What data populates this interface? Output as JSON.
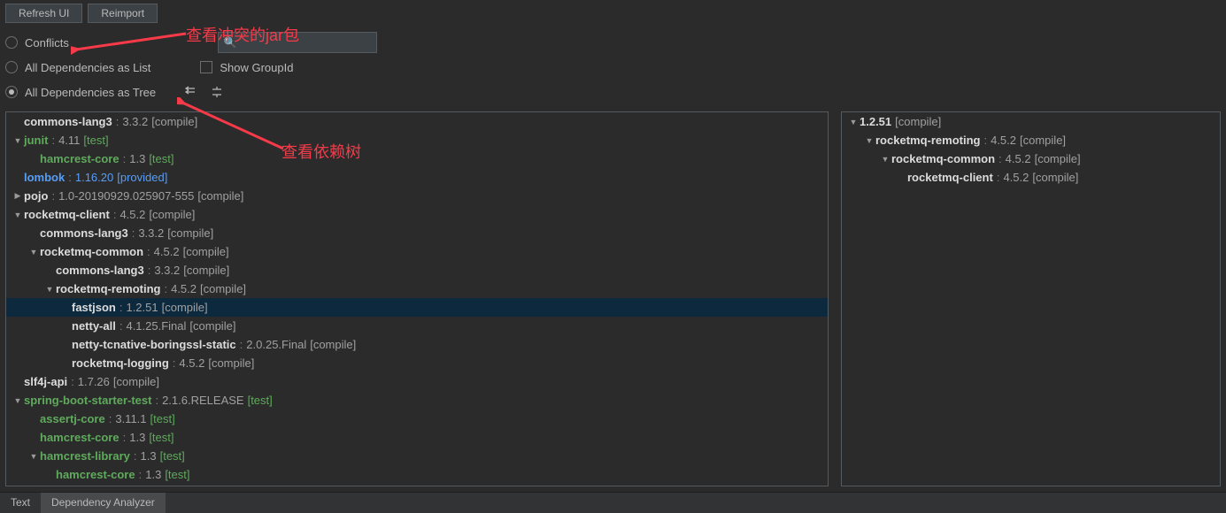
{
  "toolbar": {
    "refresh_label": "Refresh UI",
    "reimport_label": "Reimport"
  },
  "view": {
    "conflicts_label": "Conflicts",
    "list_label": "All Dependencies as List",
    "tree_label": "All Dependencies as Tree",
    "show_groupid_label": "Show GroupId",
    "search_placeholder": ""
  },
  "annotations": {
    "conflicts_note": "查看冲突的jar包",
    "tree_note": "查看依赖树"
  },
  "left_tree": [
    {
      "indent": 0,
      "tri": "none",
      "artifact": "commons-lang3",
      "aclass": "white",
      "sep": ":",
      "ver": "3.3.2",
      "scope": "[compile]",
      "vclass": "",
      "sclass": "",
      "sel": false
    },
    {
      "indent": 0,
      "tri": "down",
      "artifact": "junit",
      "aclass": "green",
      "sep": ":",
      "ver": "4.11",
      "scope": "[test]",
      "vclass": "",
      "sclass": "green",
      "sel": false
    },
    {
      "indent": 1,
      "tri": "none",
      "artifact": "hamcrest-core",
      "aclass": "green",
      "sep": ":",
      "ver": "1.3",
      "scope": "[test]",
      "vclass": "",
      "sclass": "green",
      "sel": false
    },
    {
      "indent": 0,
      "tri": "none",
      "artifact": "lombok",
      "aclass": "blue",
      "sep": ":",
      "ver": "1.16.20",
      "scope": "[provided]",
      "vclass": "blue",
      "sclass": "blue",
      "sel": false
    },
    {
      "indent": 0,
      "tri": "right",
      "artifact": "pojo",
      "aclass": "white",
      "sep": ":",
      "ver": "1.0-20190929.025907-555",
      "scope": "[compile]",
      "vclass": "",
      "sclass": "",
      "sel": false
    },
    {
      "indent": 0,
      "tri": "down",
      "artifact": "rocketmq-client",
      "aclass": "white",
      "sep": ":",
      "ver": "4.5.2",
      "scope": "[compile]",
      "vclass": "",
      "sclass": "",
      "sel": false
    },
    {
      "indent": 1,
      "tri": "none",
      "artifact": "commons-lang3",
      "aclass": "white",
      "sep": ":",
      "ver": "3.3.2",
      "scope": "[compile]",
      "vclass": "",
      "sclass": "",
      "sel": false
    },
    {
      "indent": 1,
      "tri": "down",
      "artifact": "rocketmq-common",
      "aclass": "white",
      "sep": ":",
      "ver": "4.5.2",
      "scope": "[compile]",
      "vclass": "",
      "sclass": "",
      "sel": false
    },
    {
      "indent": 2,
      "tri": "none",
      "artifact": "commons-lang3",
      "aclass": "white",
      "sep": ":",
      "ver": "3.3.2",
      "scope": "[compile]",
      "vclass": "",
      "sclass": "",
      "sel": false
    },
    {
      "indent": 2,
      "tri": "down",
      "artifact": "rocketmq-remoting",
      "aclass": "white",
      "sep": ":",
      "ver": "4.5.2",
      "scope": "[compile]",
      "vclass": "",
      "sclass": "",
      "sel": false
    },
    {
      "indent": 3,
      "tri": "none",
      "artifact": "fastjson",
      "aclass": "white",
      "sep": ":",
      "ver": "1.2.51",
      "scope": "[compile]",
      "vclass": "",
      "sclass": "",
      "sel": true
    },
    {
      "indent": 3,
      "tri": "none",
      "artifact": "netty-all",
      "aclass": "white",
      "sep": ":",
      "ver": "4.1.25.Final",
      "scope": "[compile]",
      "vclass": "",
      "sclass": "",
      "sel": false
    },
    {
      "indent": 3,
      "tri": "none",
      "artifact": "netty-tcnative-boringssl-static",
      "aclass": "white",
      "sep": ":",
      "ver": "2.0.25.Final",
      "scope": "[compile]",
      "vclass": "",
      "sclass": "",
      "sel": false
    },
    {
      "indent": 3,
      "tri": "none",
      "artifact": "rocketmq-logging",
      "aclass": "white",
      "sep": ":",
      "ver": "4.5.2",
      "scope": "[compile]",
      "vclass": "",
      "sclass": "",
      "sel": false
    },
    {
      "indent": 0,
      "tri": "none",
      "artifact": "slf4j-api",
      "aclass": "white",
      "sep": ":",
      "ver": "1.7.26",
      "scope": "[compile]",
      "vclass": "",
      "sclass": "",
      "sel": false
    },
    {
      "indent": 0,
      "tri": "down",
      "artifact": "spring-boot-starter-test",
      "aclass": "green",
      "sep": ":",
      "ver": "2.1.6.RELEASE",
      "scope": "[test]",
      "vclass": "",
      "sclass": "green",
      "sel": false
    },
    {
      "indent": 1,
      "tri": "none",
      "artifact": "assertj-core",
      "aclass": "green",
      "sep": ":",
      "ver": "3.11.1",
      "scope": "[test]",
      "vclass": "",
      "sclass": "green",
      "sel": false
    },
    {
      "indent": 1,
      "tri": "none",
      "artifact": "hamcrest-core",
      "aclass": "green",
      "sep": ":",
      "ver": "1.3",
      "scope": "[test]",
      "vclass": "",
      "sclass": "green",
      "sel": false
    },
    {
      "indent": 1,
      "tri": "down",
      "artifact": "hamcrest-library",
      "aclass": "green",
      "sep": ":",
      "ver": "1.3",
      "scope": "[test]",
      "vclass": "",
      "sclass": "green",
      "sel": false
    },
    {
      "indent": 2,
      "tri": "none",
      "artifact": "hamcrest-core",
      "aclass": "green",
      "sep": ":",
      "ver": "1.3",
      "scope": "[test]",
      "vclass": "",
      "sclass": "green",
      "sel": false
    }
  ],
  "right_tree": [
    {
      "indent": 0,
      "tri": "down",
      "artifact": "1.2.51",
      "aclass": "white",
      "sep": "",
      "ver": "",
      "scope": "[compile]",
      "vclass": "",
      "sclass": "",
      "sel": false
    },
    {
      "indent": 1,
      "tri": "down",
      "artifact": "rocketmq-remoting",
      "aclass": "white",
      "sep": ":",
      "ver": "4.5.2",
      "scope": "[compile]",
      "vclass": "",
      "sclass": "",
      "sel": false
    },
    {
      "indent": 2,
      "tri": "down",
      "artifact": "rocketmq-common",
      "aclass": "white",
      "sep": ":",
      "ver": "4.5.2",
      "scope": "[compile]",
      "vclass": "",
      "sclass": "",
      "sel": false
    },
    {
      "indent": 3,
      "tri": "none",
      "artifact": "rocketmq-client",
      "aclass": "white",
      "sep": ":",
      "ver": "4.5.2",
      "scope": "[compile]",
      "vclass": "",
      "sclass": "",
      "sel": false
    }
  ],
  "tabs": {
    "text_label": "Text",
    "analyzer_label": "Dependency Analyzer"
  }
}
